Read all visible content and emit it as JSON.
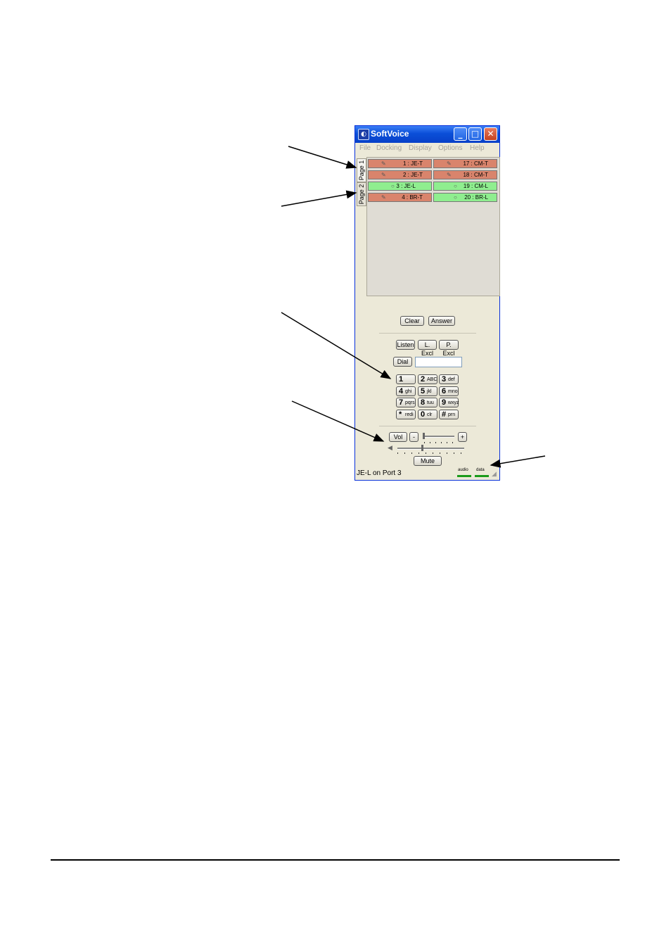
{
  "window": {
    "title": "SoftVoice",
    "buttons": {
      "minimize": "_",
      "maximize": "□",
      "close": "✕"
    },
    "menu": [
      "File",
      "Docking",
      "Display",
      "Options",
      "Help"
    ]
  },
  "tabs": [
    "Page 1",
    "Page 2"
  ],
  "ports": [
    {
      "label": "1 : JE-T",
      "state": "talk",
      "icon": "handset-icon"
    },
    {
      "label": "17 : CM-T",
      "state": "talk",
      "icon": "handset-icon"
    },
    {
      "label": "2 : JE-T",
      "state": "talk",
      "icon": "handset-icon"
    },
    {
      "label": "18 : CM-T",
      "state": "talk",
      "icon": "handset-icon"
    },
    {
      "label": "3 : JE-L",
      "state": "listen",
      "icon": "listen-icon"
    },
    {
      "label": "19 : CM-L",
      "state": "listen",
      "icon": "listen-icon"
    },
    {
      "label": "4 : BR-T",
      "state": "talk",
      "icon": "handset-icon"
    },
    {
      "label": "20 : BR-L",
      "state": "listen",
      "icon": "listen-icon"
    }
  ],
  "colors": {
    "talk": "#d9846c",
    "listen": "#8fee8f",
    "title_bar": "#0a4fd8"
  },
  "controls": {
    "clear": "Clear",
    "answer": "Answer",
    "listen": "Listen",
    "l_excl": "L. Excl",
    "p_excl": "P. Excl",
    "dial": "Dial",
    "dial_value": "",
    "vol": "Vol",
    "minus": "-",
    "plus": "+",
    "mute": "Mute"
  },
  "keypad": [
    {
      "digit": "1",
      "letters": ""
    },
    {
      "digit": "2",
      "letters": "ABC"
    },
    {
      "digit": "3",
      "letters": "def"
    },
    {
      "digit": "4",
      "letters": "ghi"
    },
    {
      "digit": "5",
      "letters": "jkl"
    },
    {
      "digit": "6",
      "letters": "mno"
    },
    {
      "digit": "7",
      "letters": "pqrs"
    },
    {
      "digit": "8",
      "letters": "tuu"
    },
    {
      "digit": "9",
      "letters": "wxyz"
    },
    {
      "digit": "*",
      "letters": "redi"
    },
    {
      "digit": "0",
      "letters": "clr"
    },
    {
      "digit": "#",
      "letters": "prn"
    }
  ],
  "status": {
    "text": "JE-L on Port  3",
    "audio": "audio",
    "data": "data"
  },
  "speaker_icon": "speaker-icon"
}
